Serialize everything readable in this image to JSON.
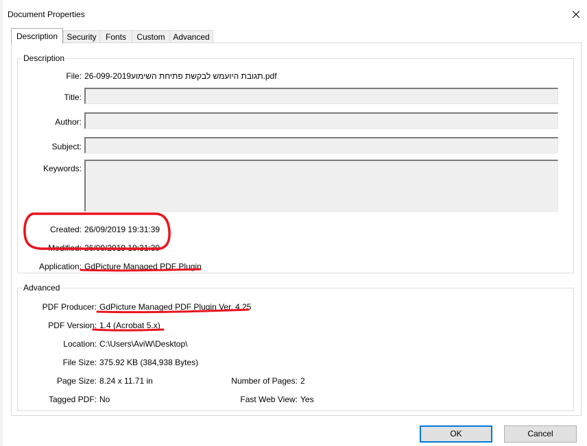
{
  "window": {
    "title": "Document Properties"
  },
  "tabs": [
    {
      "label": "Description"
    },
    {
      "label": "Security"
    },
    {
      "label": "Fonts"
    },
    {
      "label": "Custom"
    },
    {
      "label": "Advanced"
    }
  ],
  "description": {
    "group_label": "Description",
    "file_label": "File:",
    "file_value": "תגובת היועמש לבקשת פתיחת השימוע26-099-2019.pdf",
    "title_label": "Title:",
    "title_value": "",
    "author_label": "Author:",
    "author_value": "",
    "subject_label": "Subject:",
    "subject_value": "",
    "keywords_label": "Keywords:",
    "keywords_value": "",
    "created_label": "Created:",
    "created_value": "26/09/2019 19:31:39",
    "modified_label": "Modified:",
    "modified_value": "26/09/2019 19:31:39",
    "application_label": "Application:",
    "application_value": "GdPicture Managed PDF Plugin"
  },
  "advanced": {
    "group_label": "Advanced",
    "producer_label": "PDF Producer:",
    "producer_value": "GdPicture Managed PDF Plugin Ver. 4.25",
    "version_label": "PDF Version:",
    "version_value": "1.4 (Acrobat 5.x)",
    "location_label": "Location:",
    "location_value": "C:\\Users\\AviW\\Desktop\\",
    "filesize_label": "File Size:",
    "filesize_value": "375.92 KB (384,938 Bytes)",
    "pagesize_label": "Page Size:",
    "pagesize_value": "8.24 x 11.71 in",
    "numpages_label": "Number of Pages:",
    "numpages_value": "2",
    "tagged_label": "Tagged PDF:",
    "tagged_value": "No",
    "fastweb_label": "Fast Web View:",
    "fastweb_value": "Yes"
  },
  "buttons": {
    "ok": "OK",
    "cancel": "Cancel"
  },
  "colors": {
    "annotation": "#e8141e",
    "default_button_border": "#0078d7"
  }
}
